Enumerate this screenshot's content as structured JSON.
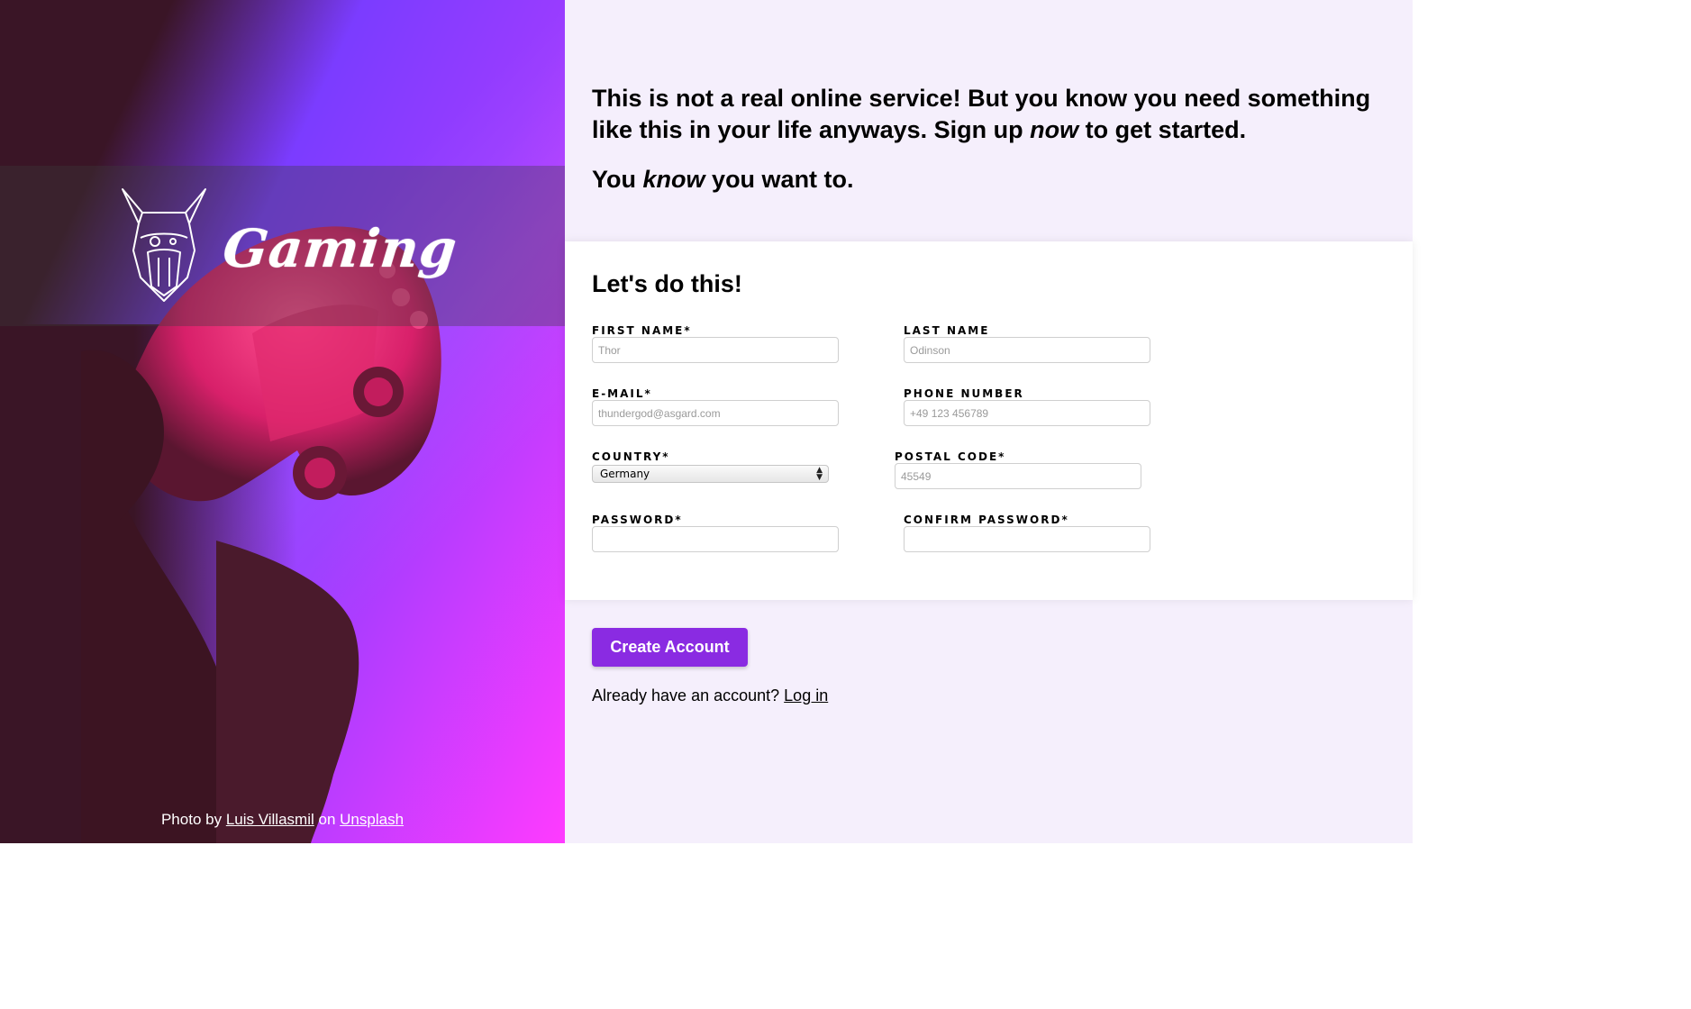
{
  "hero": {
    "brand_name": "Gaming",
    "credit_prefix": "Photo by",
    "credit_author": "Luis Villasmil",
    "credit_on": "on",
    "credit_site": "Unsplash"
  },
  "intro": {
    "line1_a": "This is not a real online service! But you know you need something like this in your life anyways. Sign up",
    "line1_em": "now",
    "line1_b": "to get started.",
    "line2_a": "You",
    "line2_em": "know",
    "line2_b": "you want to."
  },
  "form": {
    "title": "Let's do this!",
    "first_name": {
      "label": "FIRST NAME*",
      "placeholder": "Thor"
    },
    "last_name": {
      "label": "LAST NAME",
      "placeholder": "Odinson"
    },
    "email": {
      "label": "E-MAIL*",
      "placeholder": "thundergod@asgard.com"
    },
    "phone": {
      "label": "PHONE NUMBER",
      "placeholder": "+49 123 456789"
    },
    "country": {
      "label": "COUNTRY*",
      "value": "Germany"
    },
    "postal": {
      "label": "POSTAL CODE*",
      "placeholder": "45549"
    },
    "password": {
      "label": "PASSWORD*",
      "placeholder": ""
    },
    "confirm": {
      "label": "CONFIRM PASSWORD*",
      "placeholder": ""
    }
  },
  "actions": {
    "create_label": "Create Account",
    "login_prompt": "Already have an account?",
    "login_link": "Log in"
  },
  "colors": {
    "accent": "#8a2be2",
    "right_bg": "#f5effc"
  }
}
